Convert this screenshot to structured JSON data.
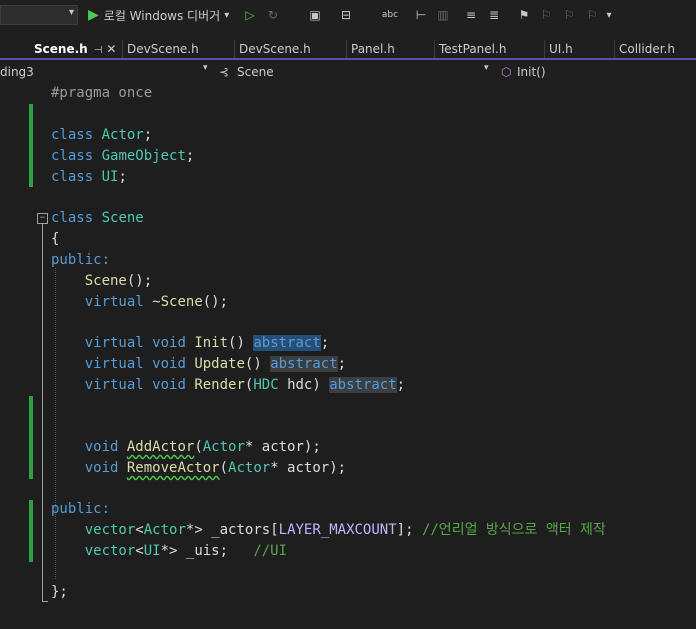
{
  "toolbar": {
    "debugger_label": "로컬 Windows 디버거",
    "debugger_arrow": "▾"
  },
  "tabs": [
    {
      "label": "Scene.h",
      "pin": "⊣",
      "close": "✕"
    },
    {
      "label": "DevScene.h"
    },
    {
      "label": "DevScene.h"
    },
    {
      "label": "Panel.h"
    },
    {
      "label": "TestPanel.h"
    },
    {
      "label": "UI.h"
    },
    {
      "label": "Collider.h"
    }
  ],
  "navbar": {
    "project": "ding3",
    "scope": "Scene",
    "member": "Init()"
  },
  "code": {
    "l1": "#pragma once",
    "l3_kw": "class",
    "l3_name": "Actor",
    "l4_kw": "class",
    "l4_name": "GameObject",
    "l5_kw": "class",
    "l5_name": "UI",
    "l7_kw": "class",
    "l7_name": "Scene",
    "l8": "{",
    "l9": "public:",
    "l10_name": "Scene",
    "l11_kw": "virtual",
    "l11_name": "~Scene",
    "l13_kw1": "virtual",
    "l13_kw2": "void",
    "l13_fn": "Init",
    "l13_abs": "abstract",
    "l14_kw1": "virtual",
    "l14_kw2": "void",
    "l14_fn": "Update",
    "l14_abs": "abstract",
    "l15_kw1": "virtual",
    "l15_kw2": "void",
    "l15_fn": "Render",
    "l15_type": "HDC",
    "l15_param": "hdc",
    "l15_abs": "abstract",
    "l18_kw": "void",
    "l18_fn": "AddActor",
    "l18_type": "Actor",
    "l18_param": "actor",
    "l19_kw": "void",
    "l19_fn": "RemoveActor",
    "l19_type": "Actor",
    "l19_param": "actor",
    "l21": "public:",
    "l22_ty": "vector",
    "l22_arg": "Actor",
    "l22_var": "_actors",
    "l22_mac": "LAYER_MAXCOUNT",
    "l22_cm": "//언리얼 방식으로 액터 제작",
    "l23_ty": "vector",
    "l23_arg": "UI",
    "l23_var": "_uis",
    "l23_cm": "//UI",
    "l26": "};"
  },
  "colors": {
    "keyword": "#569cd6",
    "type": "#4ec9b0",
    "function": "#dcdcaa",
    "comment": "#57a64a",
    "macro": "#beb7ff",
    "change_bar": "#2ea043",
    "selection": "#264f78"
  }
}
